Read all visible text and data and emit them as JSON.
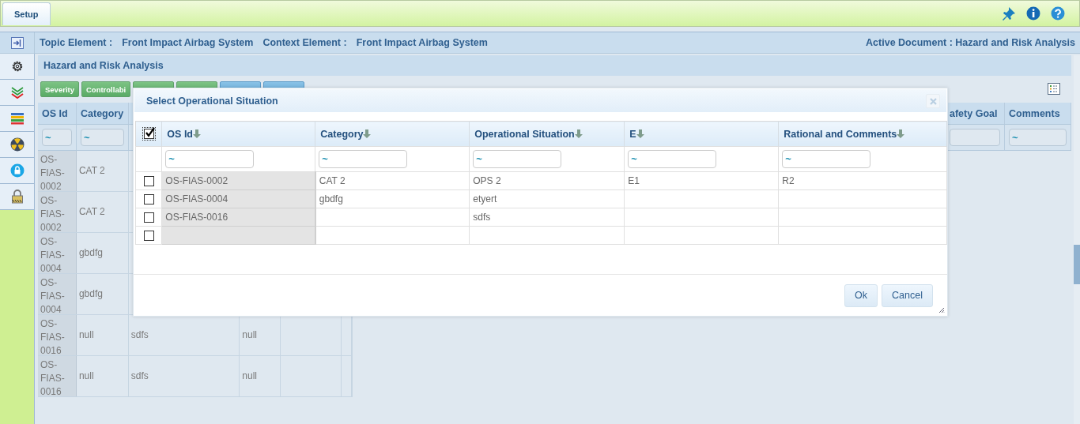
{
  "top_bar": {
    "tabs": [
      {
        "label": "Setup",
        "selected": true
      }
    ]
  },
  "context_bar": {
    "topic_label": "Topic Element :",
    "topic_value": "Front Impact Airbag System",
    "context_label": "Context Element :",
    "context_value": "Front Impact Airbag System",
    "active_document": "Active Document : Hazard and Risk Analysis"
  },
  "panel": {
    "title": "Hazard and Risk Analysis",
    "toolbar_buttons": [
      {
        "label": "Severity",
        "kind": "action"
      },
      {
        "label": "Controllabi",
        "kind": "action"
      },
      {
        "kind": "action"
      },
      {
        "kind": "action"
      },
      {
        "kind": "utility"
      },
      {
        "kind": "utility"
      }
    ],
    "grid": {
      "columns_left": [
        {
          "label": "OS Id",
          "filter": "~"
        },
        {
          "label": "Category",
          "filter": "~"
        }
      ],
      "columns_right": [
        {
          "label": "afety Goal"
        },
        {
          "label": "Comments",
          "filter": "~"
        }
      ],
      "rows": [
        {
          "cells": [
            "OS-FIAS-0002",
            "CAT 2",
            null,
            null
          ]
        },
        {
          "cells": [
            "OS-FIAS-0002",
            "CAT 2",
            null,
            null
          ]
        },
        {
          "cells": [
            "OS-FIAS-0004",
            "gbdfg",
            null,
            null
          ]
        },
        {
          "cells": [
            "OS-FIAS-0004",
            "gbdfg",
            null,
            null
          ]
        },
        {
          "cells": [
            "OS-FIAS-0016",
            "null",
            "sdfs",
            "null"
          ]
        },
        {
          "cells": [
            "OS-FIAS-0016",
            "null",
            "sdfs",
            "null"
          ]
        }
      ]
    }
  },
  "dialog": {
    "title": "Select Operational Situation",
    "select_all_checked": true,
    "columns": [
      {
        "label": "OS Id",
        "filter": "~"
      },
      {
        "label": "Category",
        "filter": "~"
      },
      {
        "label": "Operational Situation",
        "filter": "~"
      },
      {
        "label": "E",
        "filter": "~"
      },
      {
        "label": "Rational and Comments",
        "filter": "~"
      }
    ],
    "rows": [
      {
        "checked": false,
        "cells": [
          "OS-FIAS-0002",
          "CAT 2",
          "OPS 2",
          "E1",
          "R2"
        ]
      },
      {
        "checked": false,
        "cells": [
          "OS-FIAS-0004",
          "gbdfg",
          "etyert",
          null,
          null
        ]
      },
      {
        "checked": false,
        "cells": [
          "OS-FIAS-0016",
          null,
          "sdfs",
          null,
          null
        ]
      },
      {
        "checked": false,
        "cells": [
          null,
          null,
          null,
          null,
          null
        ]
      }
    ],
    "buttons": [
      "Ok",
      "Cancel"
    ]
  }
}
